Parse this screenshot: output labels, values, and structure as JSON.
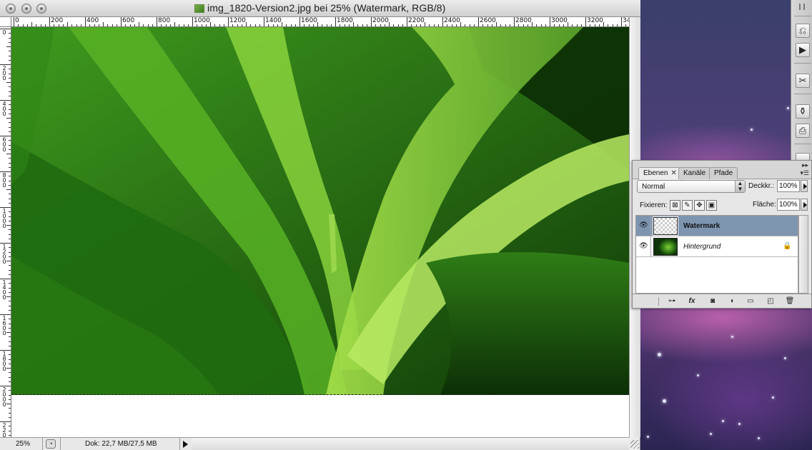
{
  "document": {
    "title": "img_1820-Version2.jpg bei 25% (Watermark, RGB/8)",
    "ruler_h_labels": [
      "0",
      "200",
      "400",
      "600",
      "800",
      "1000",
      "1200",
      "1400",
      "1600",
      "1800",
      "2000",
      "2200",
      "2400",
      "2600",
      "2800",
      "3000",
      "3200",
      "34"
    ],
    "ruler_v_labels": [
      "0",
      "2 0 0",
      "4 0 0",
      "6 0 0",
      "8 0 0",
      "1 0 0 0",
      "1 2 0 0",
      "1 4 0 0",
      "1 6 0 0",
      "1 8 0 0",
      "2 0 0 0",
      "2 2 0"
    ]
  },
  "status_bar": {
    "zoom": "25%",
    "doc_size": "Dok: 22,7 MB/27,5 MB"
  },
  "layers_panel": {
    "tabs": [
      {
        "label": "Ebenen",
        "active": true,
        "closable": true
      },
      {
        "label": "Kanäle",
        "active": false
      },
      {
        "label": "Pfade",
        "active": false
      }
    ],
    "blend_mode": "Normal",
    "opacity_label": "Deckkr.:",
    "opacity_value": "100%",
    "lock_label": "Fixieren:",
    "fill_label": "Fläche:",
    "fill_value": "100%",
    "layers": [
      {
        "name": "Watermark",
        "selected": true,
        "visible": true,
        "locked": false,
        "thumbnail": "transparent"
      },
      {
        "name": "Hintergrund",
        "selected": false,
        "visible": true,
        "locked": true,
        "thumbnail": "photo"
      }
    ],
    "footer_icons": [
      "link-icon",
      "fx-icon",
      "mask-icon",
      "adjustment-icon",
      "folder-icon",
      "new-layer-icon",
      "trash-icon"
    ]
  },
  "dock": {
    "icons": [
      "history-icon",
      "actions-icon",
      "tool-presets-icon",
      "brushes-icon",
      "clone-source-icon",
      "layer-comps-icon"
    ]
  }
}
